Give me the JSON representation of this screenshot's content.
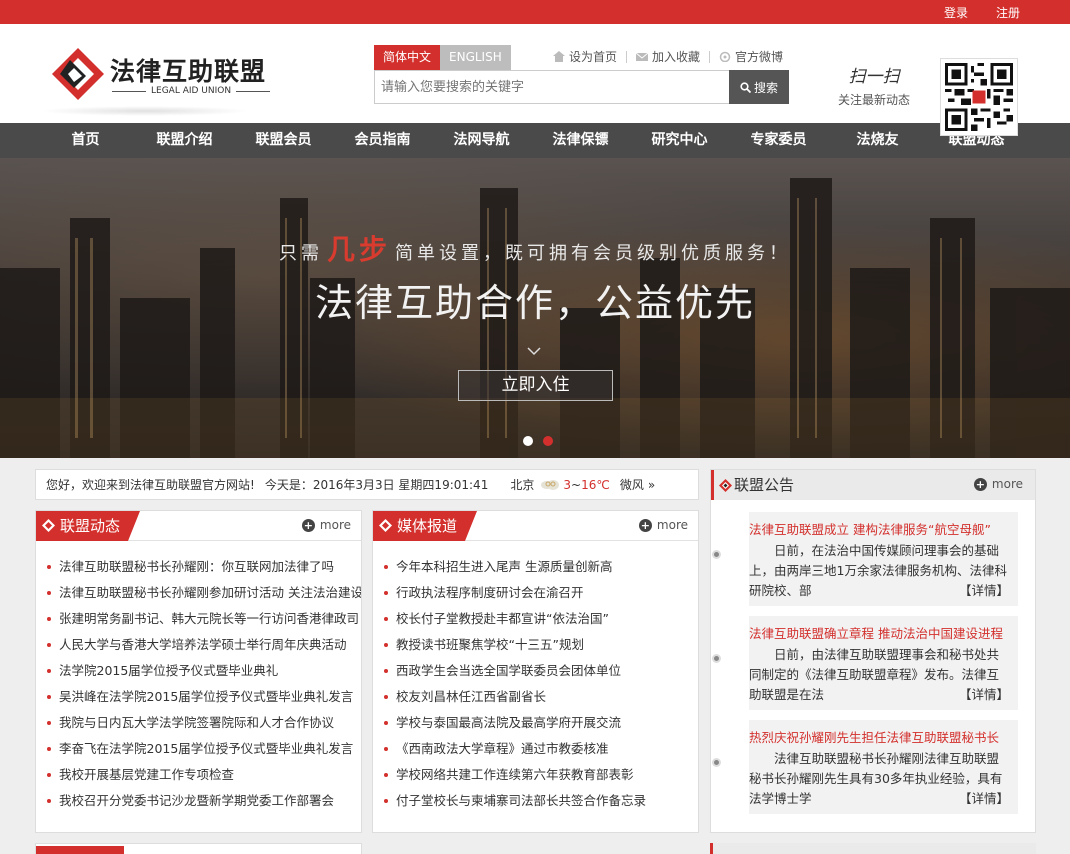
{
  "topbar": {
    "login": "登录",
    "register": "注册"
  },
  "logo": {
    "name_cn": "法律互助联盟",
    "name_en": "LEGAL AID UNION"
  },
  "header": {
    "lang_active": "简体中文",
    "lang_other": "ENGLISH",
    "set_home": "设为首页",
    "add_fav": "加入收藏",
    "weibo": "官方微博",
    "search_placeholder": "请输入您要搜索的关键字",
    "search_button": "搜索",
    "scan_title": "扫一扫",
    "scan_sub": "关注最新动态"
  },
  "nav": [
    "首页",
    "联盟介绍",
    "联盟会员",
    "会员指南",
    "法网导航",
    "法律保镖",
    "研究中心",
    "专家委员",
    "法烧友",
    "联盟动态"
  ],
  "banner": {
    "tag_before": "只需",
    "tag_highlight": "几步",
    "tag_after": "简单设置，既可拥有会员级别优质服务！",
    "headline": "法律互助合作，公益优先",
    "button": "立即入住"
  },
  "colors": {
    "brand_red": "#d3302d",
    "nav_bg": "#4a4a4a",
    "dot_active": "#d3302d",
    "dot_inactive": "#ffffff"
  },
  "welcome": {
    "text": "您好，欢迎来到法律互助联盟官方网站!",
    "date": "今天是：2016年3月3日 星期四19:01:41",
    "city": "北京",
    "temp_low": "3",
    "temp_sep": "~",
    "temp_high": "16℃",
    "wind": "微风",
    "arrow": "»"
  },
  "alliance_news": {
    "title": "联盟动态",
    "more": "more",
    "items": [
      "法律互助联盟秘书长孙耀刚：你互联网加法律了吗",
      "法律互助联盟秘书长孙耀刚参加研讨活动 关注法治建设",
      "张建明常务副书记、韩大元院长等一行访问香港律政司",
      "人民大学与香港大学培养法学硕士举行周年庆典活动",
      "法学院2015届学位授予仪式暨毕业典礼",
      "吴洪峰在法学院2015届学位授予仪式暨毕业典礼发言",
      "我院与日内瓦大学法学院签署院际和人才合作协议",
      "李奋飞在法学院2015届学位授予仪式暨毕业典礼发言",
      "我校开展基层党建工作专项检查",
      "我校召开分党委书记沙龙暨新学期党委工作部署会"
    ]
  },
  "media_news": {
    "title": "媒体报道",
    "more": "more",
    "items": [
      "今年本科招生进入尾声 生源质量创新高",
      "行政执法程序制度研讨会在渝召开",
      "校长付子堂教授赴丰都宣讲“依法治国”",
      "教授读书班聚焦学校“十三五”规划",
      "西政学生会当选全国学联委员会团体单位",
      "校友刘昌林任江西省副省长",
      "学校与泰国最高法院及最高学府开展交流",
      "《西南政法大学章程》通过市教委核准",
      "学校网络共建工作连续第六年获教育部表彰",
      "付子堂校长与柬埔寨司法部长共签合作备忘录"
    ]
  },
  "notices": {
    "title": "联盟公告",
    "more": "more",
    "detail": "【详情】",
    "items": [
      {
        "title": "法律互助联盟成立 建构法律服务“航空母舰”",
        "body": "日前，在法治中国传媒顾问理事会的基础上，由两岸三地1万余家法律服务机构、法律科研院校、部"
      },
      {
        "title": "法律互助联盟确立章程 推动法治中国建设进程",
        "body": "日前，由法律互助联盟理事会和秘书处共同制定的《法律互助联盟章程》发布。法律互助联盟是在法"
      },
      {
        "title": "热烈庆祝孙耀刚先生担任法律互助联盟秘书长",
        "body": "法律互助联盟秘书长孙耀刚法律互助联盟秘书长孙耀刚先生具有30多年执业经验，具有法学博士学"
      }
    ]
  }
}
